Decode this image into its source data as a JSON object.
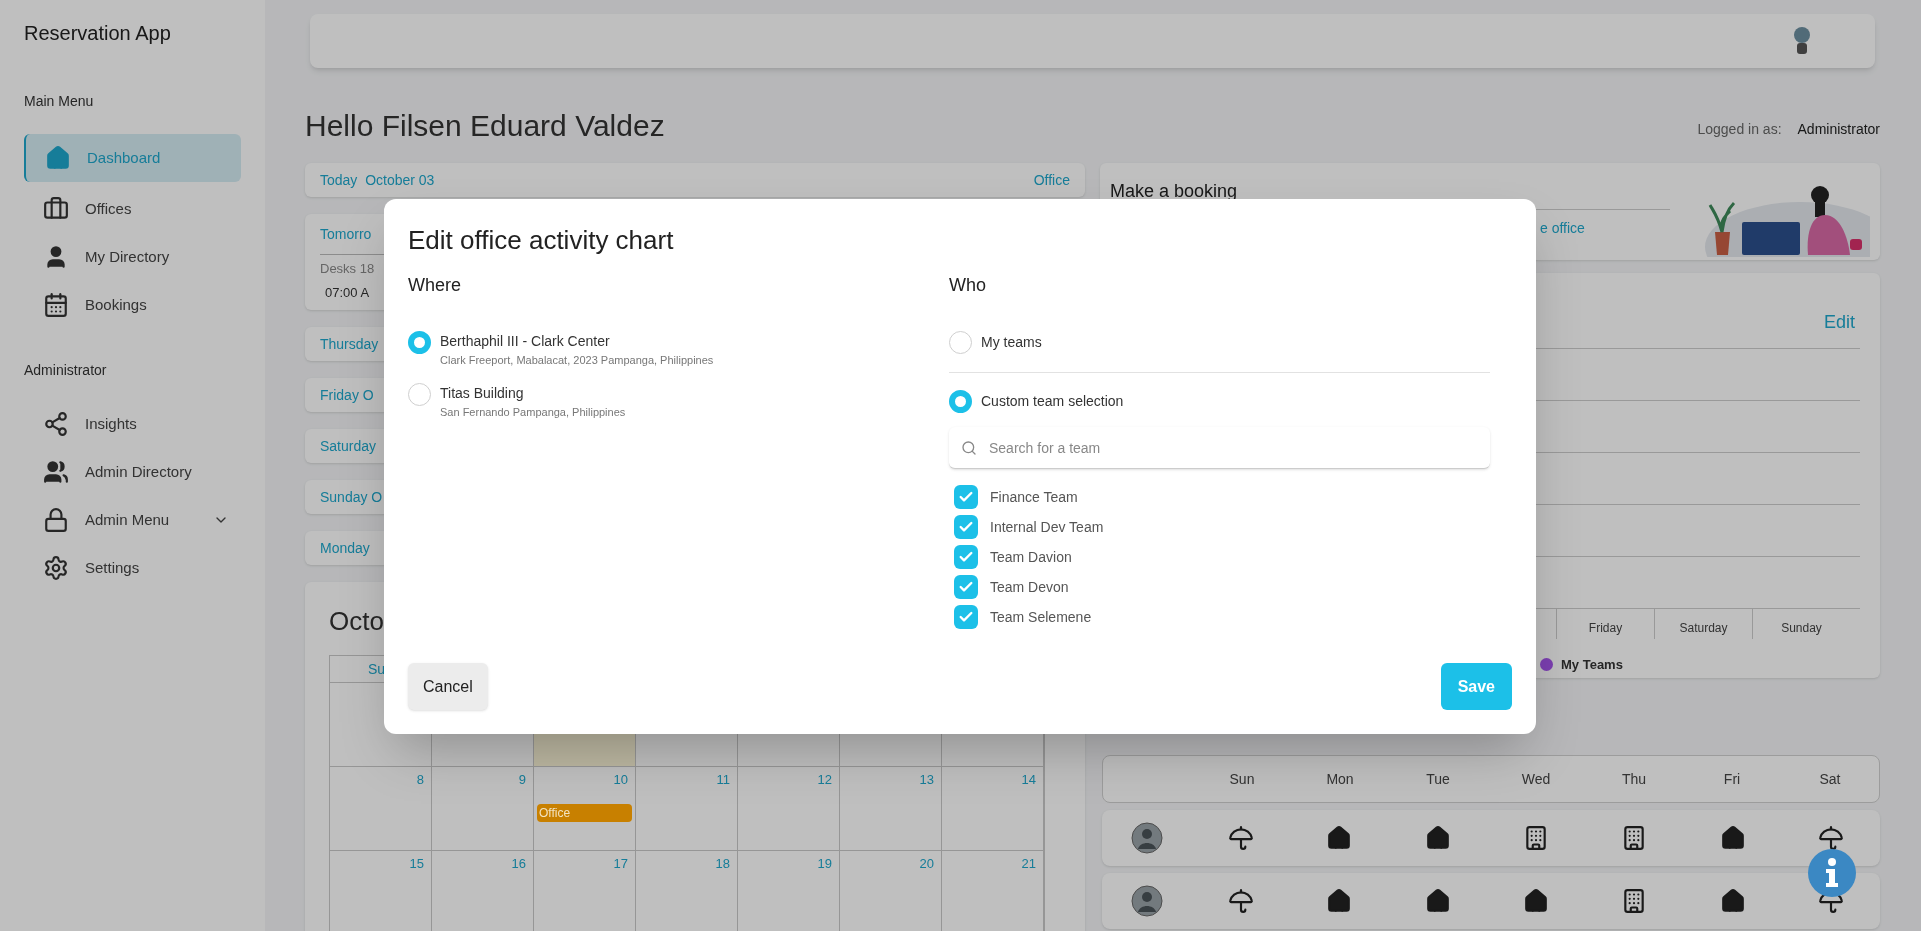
{
  "sidebar": {
    "title": "Reservation App",
    "sections": [
      {
        "heading": "Main Menu",
        "items": [
          {
            "label": "Dashboard",
            "selected": true
          },
          {
            "label": "Offices",
            "selected": false
          },
          {
            "label": "My Directory",
            "selected": false
          },
          {
            "label": "Bookings",
            "selected": false
          }
        ]
      },
      {
        "heading": "Administrator",
        "items": [
          {
            "label": "Insights",
            "selected": false
          },
          {
            "label": "Admin Directory",
            "selected": false
          },
          {
            "label": "Admin Menu",
            "selected": false,
            "expanded": false
          },
          {
            "label": "Settings",
            "selected": false
          }
        ]
      }
    ]
  },
  "header": {
    "greeting": "Hello Filsen Eduard Valdez",
    "logged_in_label": "Logged in as:",
    "role": "Administrator"
  },
  "days": [
    {
      "label": "Today  October 03",
      "status": "Office"
    },
    {
      "label": "Tomorro",
      "details": [
        "Desks 18",
        "07:00 A"
      ]
    },
    {
      "label": "Thursday"
    },
    {
      "label": "Friday O"
    },
    {
      "label": "Saturday"
    },
    {
      "label": "Sunday O"
    },
    {
      "label": "Monday"
    }
  ],
  "calendar": {
    "title": "Octo",
    "weekday": "Su",
    "weeks": [
      {
        "days": [
          {
            "today": false
          },
          {
            "today": false
          },
          {
            "today": true
          },
          {
            "today": false
          },
          {
            "today": false
          },
          {
            "today": false
          },
          {
            "today": false
          }
        ]
      },
      {
        "days": [
          {
            "date": "8",
            "today": false
          },
          {
            "date": "9",
            "today": false
          },
          {
            "date": "10",
            "today": false,
            "event": {
              "label": "Office",
              "color": "#c88000"
            }
          },
          {
            "date": "11",
            "today": false
          },
          {
            "date": "12",
            "today": false
          },
          {
            "date": "13",
            "today": false
          },
          {
            "date": "14",
            "today": false
          }
        ]
      },
      {
        "days": [
          {
            "date": "15",
            "today": false
          },
          {
            "date": "16",
            "today": false
          },
          {
            "date": "17",
            "today": false
          },
          {
            "date": "18",
            "today": false
          },
          {
            "date": "19",
            "today": false
          },
          {
            "date": "20",
            "today": false
          },
          {
            "date": "21",
            "today": false
          }
        ]
      }
    ]
  },
  "booking": {
    "title": "Make a booking",
    "link": "e office"
  },
  "activity_chart": {
    "action": "Edit",
    "x_labels": [
      "Friday",
      "Saturday",
      "Sunday"
    ],
    "legend": [
      {
        "label": "My Teams",
        "color": "#7b3fb0"
      }
    ]
  },
  "team_week": {
    "days": [
      "Sun",
      "Mon",
      "Tue",
      "Wed",
      "Thu",
      "Fri",
      "Sat"
    ],
    "rows": [
      {
        "cells": [
          {
            "kind": "umbrella"
          },
          {
            "kind": "home"
          },
          {
            "kind": "home"
          },
          {
            "kind": "building"
          },
          {
            "kind": "building"
          },
          {
            "kind": "home"
          },
          {
            "kind": "umbrella"
          }
        ]
      },
      {
        "cells": [
          {
            "kind": "umbrella"
          },
          {
            "kind": "home"
          },
          {
            "kind": "home"
          },
          {
            "kind": "home"
          },
          {
            "kind": "building"
          },
          {
            "kind": "home"
          },
          {
            "kind": "umbrella"
          }
        ]
      }
    ]
  },
  "modal": {
    "title": "Edit office activity chart",
    "where": {
      "heading": "Where",
      "options": [
        {
          "name": "Berthaphil III - Clark Center",
          "address": "Clark Freeport, Mabalacat, 2023 Pampanga, Philippines",
          "selected": true
        },
        {
          "name": "Titas Building",
          "address": "San Fernando Pampanga, Philippines",
          "selected": false
        }
      ]
    },
    "who": {
      "heading": "Who",
      "options": [
        {
          "label": "My teams",
          "selected": false
        },
        {
          "label": "Custom team selection",
          "selected": true
        }
      ],
      "search": {
        "placeholder": "Search for a team"
      },
      "teams": [
        {
          "label": "Finance Team",
          "checked": true
        },
        {
          "label": "Internal Dev Team",
          "checked": true
        },
        {
          "label": "Team Davion",
          "checked": true
        },
        {
          "label": "Team Devon",
          "checked": true
        },
        {
          "label": "Team Selemene",
          "checked": true
        }
      ]
    },
    "cancel": "Cancel",
    "save": "Save"
  }
}
